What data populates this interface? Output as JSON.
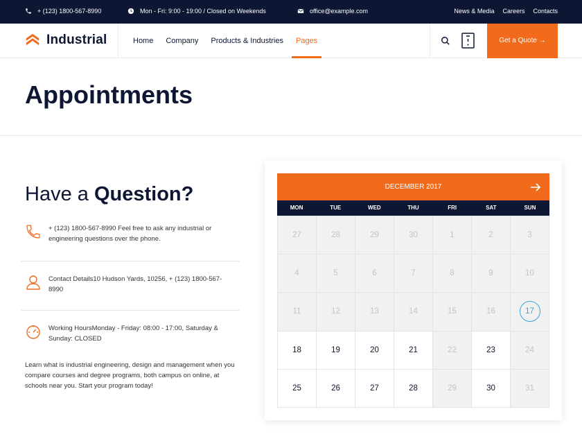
{
  "topbar": {
    "phone": "+ (123) 1800-567-8990",
    "hours": "Mon - Fri: 9:00 - 19:00 / Closed on Weekends",
    "email": "office@example.com",
    "links": [
      "News & Media",
      "Careers",
      "Contacts"
    ]
  },
  "header": {
    "brand": "Industrial",
    "nav": [
      "Home",
      "Company",
      "Products & Industries",
      "Pages"
    ],
    "active_nav": "Pages",
    "cta": "Get a Quote →"
  },
  "page": {
    "title": "Appointments"
  },
  "contact": {
    "heading_light": "Have a ",
    "heading_bold": "Question?",
    "items": [
      {
        "icon": "phone-icon",
        "text": "+ (123) 1800-567-8990 Feel free to ask any industrial or engineering questions over the phone."
      },
      {
        "icon": "user-icon",
        "text": "Contact Details10 Hudson Yards, 10256, + (123) 1800-567-8990"
      },
      {
        "icon": "gauge-icon",
        "text": "Working HoursMonday - Friday: 08:00 - 17:00, Saturday & Sunday: CLOSED"
      }
    ],
    "blurb": "Learn what is industrial engineering, design and management when you compare courses and degree programs, both campus on online, at schools near you. Start your program today!"
  },
  "calendar": {
    "month": "DECEMBER 2017",
    "weekdays": [
      "MON",
      "TUE",
      "WED",
      "THU",
      "FRI",
      "SAT",
      "SUN"
    ],
    "days": [
      {
        "d": "27",
        "s": "off"
      },
      {
        "d": "28",
        "s": "off"
      },
      {
        "d": "29",
        "s": "off"
      },
      {
        "d": "30",
        "s": "off"
      },
      {
        "d": "1",
        "s": "off"
      },
      {
        "d": "2",
        "s": "off"
      },
      {
        "d": "3",
        "s": "off"
      },
      {
        "d": "4",
        "s": "off"
      },
      {
        "d": "5",
        "s": "off"
      },
      {
        "d": "6",
        "s": "off"
      },
      {
        "d": "7",
        "s": "off"
      },
      {
        "d": "8",
        "s": "off"
      },
      {
        "d": "9",
        "s": "off"
      },
      {
        "d": "10",
        "s": "off"
      },
      {
        "d": "11",
        "s": "off"
      },
      {
        "d": "12",
        "s": "off"
      },
      {
        "d": "13",
        "s": "off"
      },
      {
        "d": "14",
        "s": "off"
      },
      {
        "d": "15",
        "s": "off"
      },
      {
        "d": "16",
        "s": "off"
      },
      {
        "d": "17",
        "s": "today"
      },
      {
        "d": "18",
        "s": "on"
      },
      {
        "d": "19",
        "s": "on"
      },
      {
        "d": "20",
        "s": "on"
      },
      {
        "d": "21",
        "s": "on"
      },
      {
        "d": "22",
        "s": "off"
      },
      {
        "d": "23",
        "s": "on"
      },
      {
        "d": "24",
        "s": "off"
      },
      {
        "d": "25",
        "s": "on"
      },
      {
        "d": "26",
        "s": "on"
      },
      {
        "d": "27",
        "s": "on"
      },
      {
        "d": "28",
        "s": "on"
      },
      {
        "d": "29",
        "s": "off"
      },
      {
        "d": "30",
        "s": "on"
      },
      {
        "d": "31",
        "s": "off"
      }
    ]
  },
  "colors": {
    "accent": "#f26a1b",
    "navy": "#0d1633",
    "today_ring": "#3aa3d6"
  }
}
